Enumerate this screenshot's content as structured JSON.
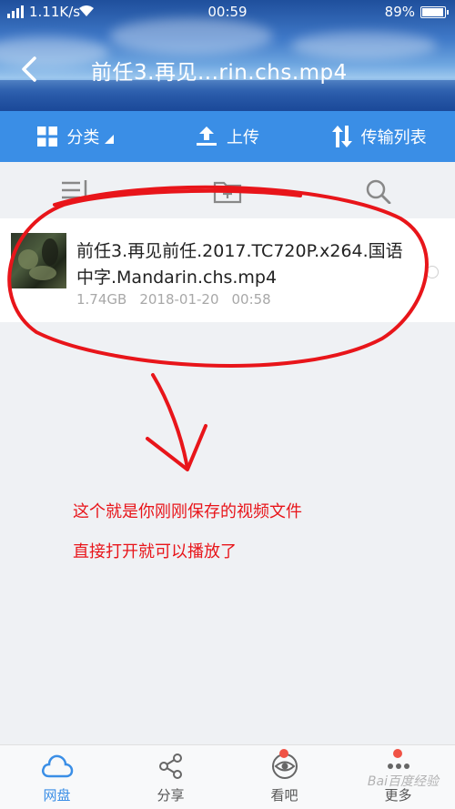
{
  "status_bar": {
    "speed": "1.11K/s",
    "time": "00:59",
    "battery_percent": "89%",
    "battery_level": 0.89
  },
  "header": {
    "title": "前任3.再见...rin.chs.mp4"
  },
  "toolbar": {
    "category_label": "分类",
    "upload_label": "上传",
    "transfer_label": "传输列表"
  },
  "file": {
    "name": "前任3.再见前任.2017.TC720P.x264.国语中字.Mandarin.chs.mp4",
    "size": "1.74GB",
    "date": "2018-01-20",
    "time": "00:58"
  },
  "annotation": {
    "line1": "这个就是你刚刚保存的视频文件",
    "line2": "直接打开就可以播放了",
    "color": "#e8151a"
  },
  "bottom_nav": {
    "items": [
      {
        "label": "网盘",
        "icon": "cloud-icon",
        "active": true
      },
      {
        "label": "分享",
        "icon": "share-icon",
        "active": false
      },
      {
        "label": "看吧",
        "icon": "eye-icon",
        "active": false,
        "badge": true
      },
      {
        "label": "更多",
        "icon": "more-icon",
        "active": false,
        "badge": true
      }
    ]
  },
  "watermark": "Bai百度经验",
  "colors": {
    "accent": "#3a8ee6",
    "background": "#eff1f4"
  }
}
